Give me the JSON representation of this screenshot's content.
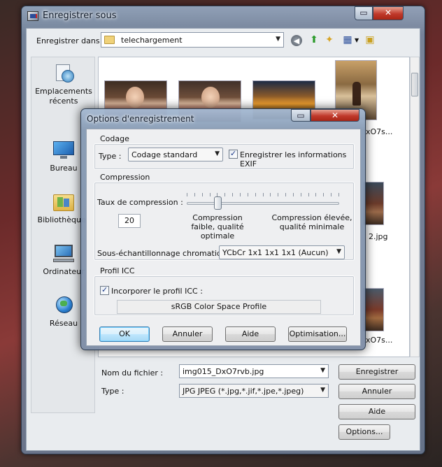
{
  "main_window": {
    "title": "Enregistrer sous",
    "save_in_label": "Enregistrer dans :",
    "save_in_value": "telechargement",
    "places": [
      {
        "label": "Emplacements récents",
        "icon": "recent-places-icon"
      },
      {
        "label": "Bureau",
        "icon": "desktop-icon"
      },
      {
        "label": "Bibliothèques",
        "icon": "libraries-icon"
      },
      {
        "label": "Ordinateur",
        "icon": "computer-icon"
      },
      {
        "label": "Réseau",
        "icon": "network-icon"
      }
    ],
    "file_labels": [
      "xO7s...",
      "2.jpg",
      "xO7s..."
    ],
    "filename_label": "Nom du fichier :",
    "filename_value": "img015_DxO7rvb.jpg",
    "filetype_label": "Type :",
    "filetype_value": "JPG JPEG  (*.jpg,*.jif,*.jpe,*.jpeg)",
    "buttons": {
      "save": "Enregistrer",
      "cancel": "Annuler",
      "help": "Aide",
      "options": "Options..."
    }
  },
  "options_dialog": {
    "title": "Options d'enregistrement",
    "codage": {
      "title": "Codage",
      "type_label": "Type :",
      "type_value": "Codage standard",
      "exif_label": "Enregistrer les informations EXIF",
      "exif_checked": true
    },
    "compression": {
      "title": "Compression",
      "ratio_label": "Taux de compression :",
      "ratio_value": "20",
      "slider_fraction": 0.2,
      "low_label": "Compression faible, qualité optimale",
      "high_label": "Compression élevée, qualité minimale",
      "subsample_label": "Sous-échantillonnage chromatique :",
      "subsample_value": "YCbCr  1x1  1x1  1x1  (Aucun)"
    },
    "icc": {
      "title": "Profil ICC",
      "embed_label": "Incorporer le profil ICC :",
      "embed_checked": true,
      "profile_value": "sRGB Color Space Profile"
    },
    "buttons": {
      "ok": "OK",
      "cancel": "Annuler",
      "help": "Aide",
      "optimisation": "Optimisation..."
    }
  },
  "colors": {
    "title_bar": "#8ea5c2",
    "close_button": "#c0392b",
    "default_button": "#a7d9f5"
  }
}
